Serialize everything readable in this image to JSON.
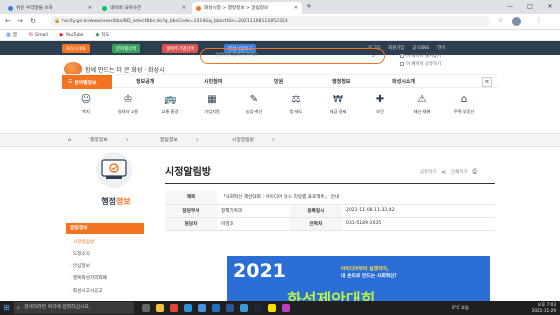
{
  "browser": {
    "tabs": [
      {
        "title": "쉬운 우리말을 쓰자",
        "color": "#3b7de0",
        "active": false
      },
      {
        "title": "네이버 국어사전",
        "color": "#03c75a",
        "active": false
      },
      {
        "title": "화성시청 > 행정정보 > 알림정보",
        "color": "#f37321",
        "active": true
      }
    ],
    "url": "hscity.go.kr/www/user/bbs/BD_selectBbs.do?q_bbsCode=1019&q_bbscttSn=20211108112852324",
    "bookmarks": [
      "앱",
      "Gmail",
      "YouTube",
      "지도"
    ],
    "window_controls": [
      "—",
      "□",
      "✕"
    ]
  },
  "sitebar": {
    "buttons": [
      {
        "label": "화성시대표",
        "color": "#f37321"
      },
      {
        "label": "분야별선택",
        "color": "#3aa15a"
      },
      {
        "label": "생애주기별선택",
        "color": "#d9534f"
      },
      {
        "label": "화성시블로그",
        "color": "#3b7de0"
      }
    ],
    "right": [
      "로그인",
      "회원가입",
      "공식SNS",
      "언어"
    ]
  },
  "header": {
    "logo_text": "함께 만드는 더 큰 화성 · 화성시",
    "search_placeholder": "검색어를 입력해 주세요",
    "checks": [
      "이 페이지 즐겨찾기",
      "이 페이지 공유하기"
    ]
  },
  "menu": {
    "category": "분야별정보",
    "items": [
      "정보공개",
      "시민참여",
      "민원",
      "행정정보",
      "화성시소개"
    ]
  },
  "quick": [
    {
      "label": "복지",
      "icon": "welfare-icon",
      "glyph": "☺"
    },
    {
      "label": "일자리·고용",
      "icon": "job-icon",
      "glyph": "♔"
    },
    {
      "label": "교통·환경",
      "icon": "traffic-icon",
      "glyph": "🚌"
    },
    {
      "label": "기업지원",
      "icon": "business-icon",
      "glyph": "▦"
    },
    {
      "label": "농업·축산",
      "icon": "agriculture-icon",
      "glyph": "✎"
    },
    {
      "label": "법·제도",
      "icon": "law-icon",
      "glyph": "⚖"
    },
    {
      "label": "세금·경제",
      "icon": "tax-icon",
      "glyph": "₩"
    },
    {
      "label": "보건",
      "icon": "health-icon",
      "glyph": "✚"
    },
    {
      "label": "재난·재해",
      "icon": "disaster-icon",
      "glyph": "⚠"
    },
    {
      "label": "주택·부동산",
      "icon": "housing-icon",
      "glyph": "⌂"
    }
  ],
  "breadcrumbs": [
    "홈",
    "행정정보",
    "알림정보",
    "시정알림방"
  ],
  "sidebar": {
    "title_a": "행정",
    "title_b": "정보",
    "section": "알림정보",
    "items": [
      {
        "label": "· 시정알림방",
        "active": true
      },
      {
        "label": "· 도정소식",
        "active": false
      },
      {
        "label": "· 안심정보",
        "active": false
      },
      {
        "label": "· 행복화성지역화폐",
        "active": false
      },
      {
        "label": "· 화성시고시공고",
        "active": false
      }
    ]
  },
  "content": {
    "title": "시정알림방",
    "tools": [
      "공유하기",
      "인쇄하기"
    ],
    "rows": [
      {
        "h1": "제목",
        "v1": "「사회혁신 제안대회 : 아이디어 유스 리빙랩 프로젝트」 안내",
        "h2": "",
        "v2": ""
      },
      {
        "h1": "담당부서",
        "v1": "정책기획과",
        "h2": "등록일시",
        "v2": "2021-11-08 11:32:42"
      },
      {
        "h1": "담당자",
        "v1": "이영호",
        "h2": "연락처",
        "v2": "031-5189-2035"
      }
    ],
    "banner": {
      "year": "2021",
      "line1": "아이디어부터 실행까지,",
      "line2": "내 손으로 만드는 사회혁신!",
      "big": "화성제안대회"
    }
  },
  "taskbar": {
    "search_placeholder": "검색하려면 여기에 입력하십시오.",
    "weather": "0°C 흐림",
    "time": "오후 7:03",
    "date": "2021-11-29",
    "apps": [
      {
        "name": "task-view-icon",
        "color": "#666"
      },
      {
        "name": "explorer-icon",
        "color": "#f3c33f"
      },
      {
        "name": "chrome-icon",
        "color": "#e0463a"
      },
      {
        "name": "edge-icon",
        "color": "#2f8fd8"
      },
      {
        "name": "store-icon",
        "color": "#4a90e2"
      },
      {
        "name": "mail-icon",
        "color": "#1f6fc5"
      },
      {
        "name": "word-icon",
        "color": "#2b5797"
      },
      {
        "name": "hwp-icon",
        "color": "#3a9ad9"
      },
      {
        "name": "steam-icon",
        "color": "#1b2838"
      },
      {
        "name": "kakao-icon",
        "color": "#f9e000"
      },
      {
        "name": "photo-icon",
        "color": "#c03fc0"
      }
    ]
  }
}
